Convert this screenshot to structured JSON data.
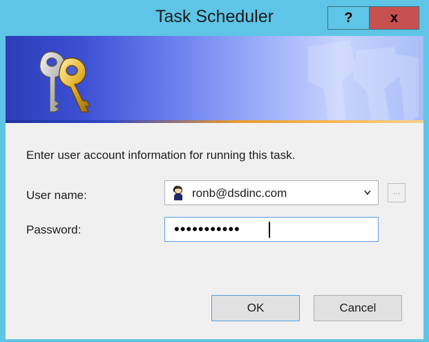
{
  "window": {
    "title": "Task Scheduler",
    "help_label": "?",
    "close_label": "x"
  },
  "dialog": {
    "prompt": "Enter user account information for running this task.",
    "user_label": "User name:",
    "user_value": "ronb@dsdinc.com",
    "browse_label": "...",
    "password_label": "Password:",
    "password_masked": "•••••••••••"
  },
  "buttons": {
    "ok_label": "OK",
    "cancel_label": "Cancel"
  },
  "icons": {
    "banner": "keys-icon",
    "user": "user-avatar-icon",
    "combo": "chevron-down-icon"
  },
  "colors": {
    "frame": "#5ec5e6",
    "close_button": "#c75050",
    "banner_start": "#2d3db8",
    "banner_end": "#c7d3fd",
    "accent_rule": "#e79a2f",
    "focus_border": "#569de5"
  }
}
